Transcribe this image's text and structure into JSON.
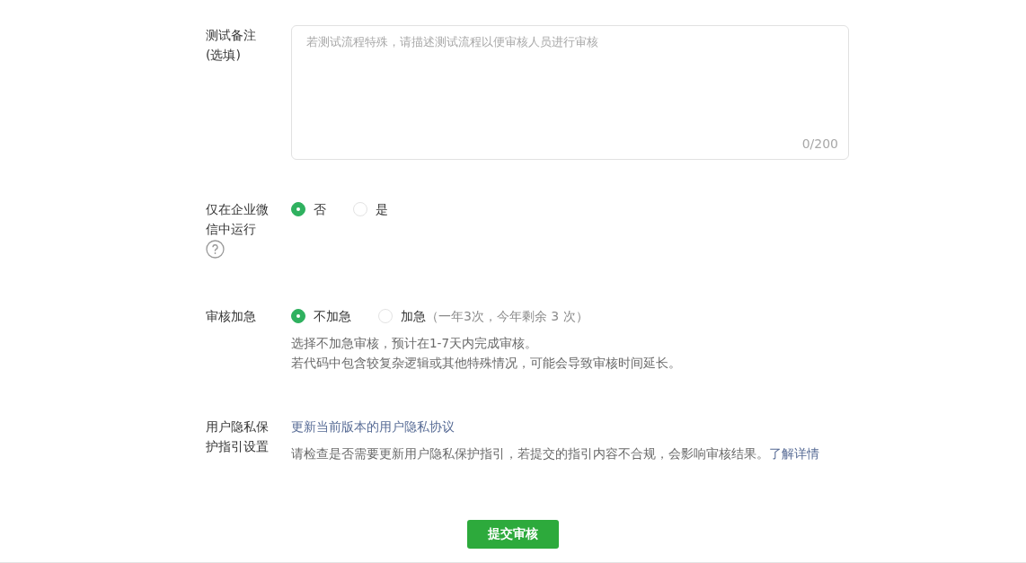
{
  "sections": [
    {
      "kind": "textarea",
      "label": "测试备注(选填)",
      "placeholder": "若测试流程特殊，请描述测试流程以便审核人员进行审核",
      "counter": "0/200"
    },
    {
      "kind": "radio",
      "label": "仅在企业微信中运行",
      "has_help": true,
      "options": [
        {
          "label": "否",
          "selected": true
        },
        {
          "label": "是",
          "selected": false
        }
      ]
    },
    {
      "kind": "radio",
      "label": "审核加急",
      "options": [
        {
          "label": "不加急",
          "selected": true
        },
        {
          "label": "加急",
          "extra": "（一年3次，今年剩余  3  次）",
          "selected": false
        }
      ],
      "notes": [
        "选择不加急审核，预计在1-7天内完成审核。",
        "若代码中包含较复杂逻辑或其他特殊情况，可能会导致审核时间延长。"
      ]
    },
    {
      "kind": "link",
      "label": "用户隐私保护指引设置",
      "link": "更新当前版本的用户隐私协议",
      "note": "请检查是否需要更新用户隐私保护指引，若提交的指引内容不合规，会影响审核结果。",
      "note_link": "了解详情"
    }
  ],
  "submit_button": "提交审核"
}
